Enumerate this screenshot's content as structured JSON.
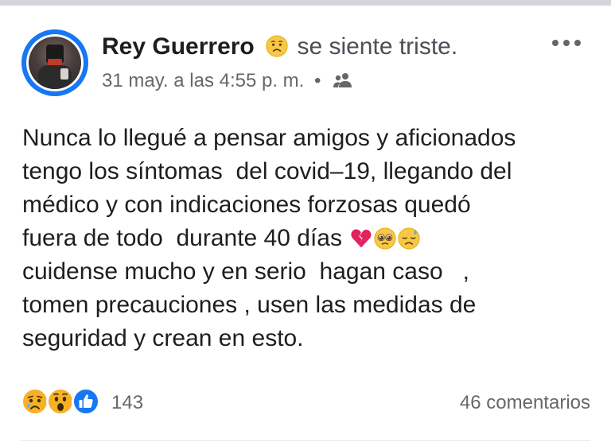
{
  "post": {
    "author": "Rey Guerrero",
    "feeling_icon": "sad-face-emoji",
    "feeling": "se siente triste.",
    "timestamp": "31 may. a las 4:55 p. m.",
    "separator": "•",
    "audience_icon": "friends-icon",
    "menu_icon": "more-options-icon",
    "body_lines": [
      "Nunca lo llegué a pensar amigos y aficionados",
      "tengo los síntomas  del covid–19, llegando del",
      "médico y con indicaciones forzosas quedó",
      "fuera de todo  durante 40 días",
      "cuidense mucho y en serio  hagan caso   ,",
      "tomen precauciones , usen las medidas de",
      "seguridad y crean en esto."
    ],
    "inline_emojis": [
      "broken-heart-emoji",
      "pleading-face-emoji",
      "downcast-sweat-emoji"
    ]
  },
  "footer": {
    "reaction_icons": [
      "sad-reaction-icon",
      "wow-reaction-icon",
      "like-reaction-icon"
    ],
    "reaction_count": "143",
    "comments": "46 comentarios"
  },
  "colors": {
    "facebook_blue": "#1877f2",
    "text": "#1c1e21",
    "secondary_text": "#65676b",
    "reaction_yellow": "#f7b125"
  }
}
